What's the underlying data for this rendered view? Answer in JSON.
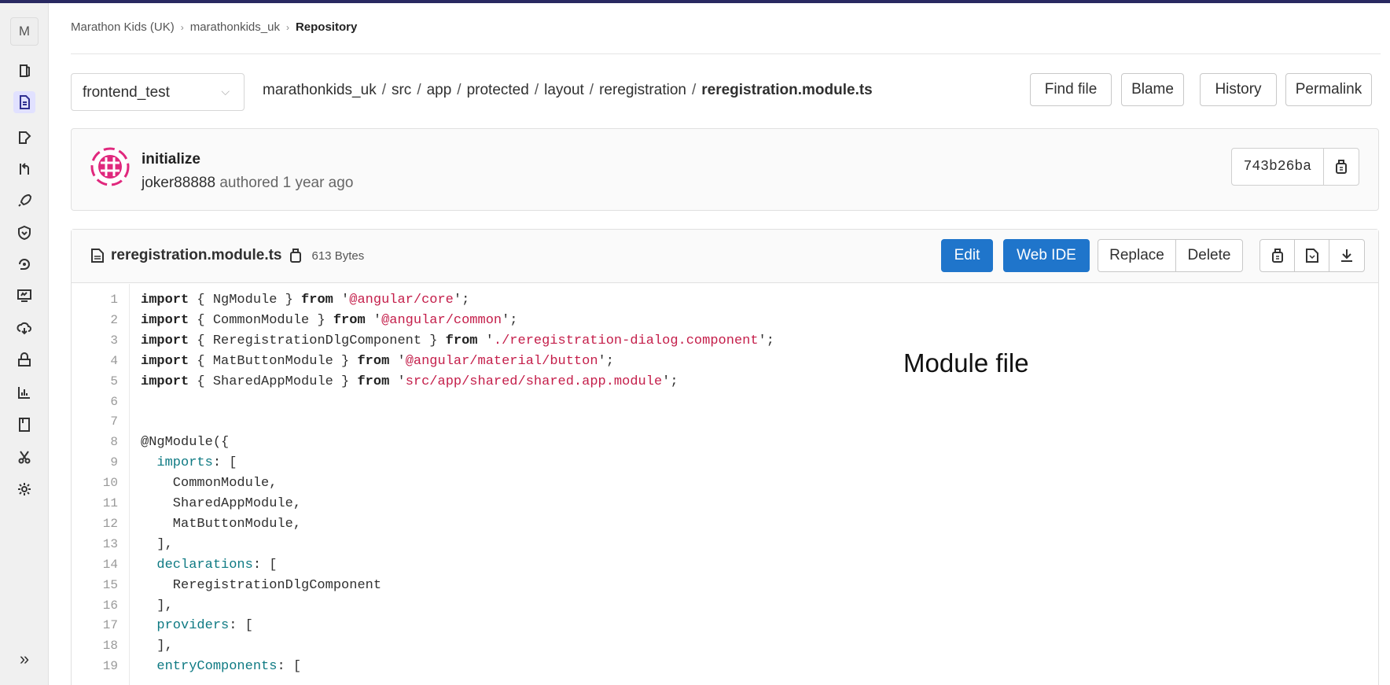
{
  "breadcrumb": {
    "items": [
      "Marathon Kids (UK)",
      "marathonkids_uk"
    ],
    "current": "Repository",
    "separator": "›"
  },
  "sidebar": {
    "avatar_letter": "M",
    "items": [
      {
        "icon": "project-overview-icon"
      },
      {
        "icon": "repository-icon",
        "active": true
      },
      {
        "icon": "issues-icon"
      },
      {
        "icon": "merge-requests-icon"
      },
      {
        "icon": "ci-cd-rocket-icon"
      },
      {
        "icon": "security-shield-icon"
      },
      {
        "icon": "deployments-icon"
      },
      {
        "icon": "monitor-icon"
      },
      {
        "icon": "infrastructure-cloud-icon"
      },
      {
        "icon": "packages-icon"
      },
      {
        "icon": "analytics-icon"
      },
      {
        "icon": "wiki-icon"
      },
      {
        "icon": "snippets-scissors-icon"
      },
      {
        "icon": "settings-gear-icon"
      }
    ],
    "collapse_label": "»"
  },
  "branch": {
    "value": "frontend_test"
  },
  "filepath": {
    "segments": [
      "marathonkids_uk",
      "src",
      "app",
      "protected",
      "layout",
      "reregistration"
    ],
    "filename": "reregistration.module.ts",
    "separator": "/"
  },
  "actions": {
    "find_file": "Find file",
    "blame": "Blame",
    "history": "History",
    "permalink": "Permalink"
  },
  "commit": {
    "title": "initialize",
    "author": "joker88888",
    "authored_text": "authored 1 year ago",
    "sha": "743b26ba"
  },
  "file": {
    "name": "reregistration.module.ts",
    "size": "613 Bytes",
    "buttons": {
      "edit": "Edit",
      "web_ide": "Web IDE",
      "replace": "Replace",
      "delete": "Delete"
    }
  },
  "code": {
    "line_numbers": [
      "1",
      "2",
      "3",
      "4",
      "5",
      "6",
      "7",
      "8",
      "9",
      "10",
      "11",
      "12",
      "13",
      "14",
      "15",
      "16",
      "17",
      "18",
      "19"
    ],
    "lines": [
      [
        {
          "t": "import",
          "c": "kw"
        },
        {
          "t": " { NgModule } "
        },
        {
          "t": "from",
          "c": "kw"
        },
        {
          "t": " '"
        },
        {
          "t": "@angular/core",
          "c": "str"
        },
        {
          "t": "';"
        }
      ],
      [
        {
          "t": "import",
          "c": "kw"
        },
        {
          "t": " { CommonModule } "
        },
        {
          "t": "from",
          "c": "kw"
        },
        {
          "t": " '"
        },
        {
          "t": "@angular/common",
          "c": "str"
        },
        {
          "t": "';"
        }
      ],
      [
        {
          "t": "import",
          "c": "kw"
        },
        {
          "t": " { ReregistrationDlgComponent } "
        },
        {
          "t": "from",
          "c": "kw"
        },
        {
          "t": " '"
        },
        {
          "t": "./reregistration-dialog.component",
          "c": "str"
        },
        {
          "t": "';"
        }
      ],
      [
        {
          "t": "import",
          "c": "kw"
        },
        {
          "t": " { MatButtonModule } "
        },
        {
          "t": "from",
          "c": "kw"
        },
        {
          "t": " '"
        },
        {
          "t": "@angular/material/button",
          "c": "str"
        },
        {
          "t": "';"
        }
      ],
      [
        {
          "t": "import",
          "c": "kw"
        },
        {
          "t": " { SharedAppModule } "
        },
        {
          "t": "from",
          "c": "kw"
        },
        {
          "t": " '"
        },
        {
          "t": "src/app/shared/shared.app.module",
          "c": "str"
        },
        {
          "t": "';"
        }
      ],
      [],
      [],
      [
        {
          "t": "@NgModule({"
        }
      ],
      [
        {
          "t": "  "
        },
        {
          "t": "imports",
          "c": "prop"
        },
        {
          "t": ": ["
        }
      ],
      [
        {
          "t": "    CommonModule,"
        }
      ],
      [
        {
          "t": "    SharedAppModule,"
        }
      ],
      [
        {
          "t": "    MatButtonModule,"
        }
      ],
      [
        {
          "t": "  ],"
        }
      ],
      [
        {
          "t": "  "
        },
        {
          "t": "declarations",
          "c": "prop"
        },
        {
          "t": ": ["
        }
      ],
      [
        {
          "t": "    ReregistrationDlgComponent"
        }
      ],
      [
        {
          "t": "  ],"
        }
      ],
      [
        {
          "t": "  "
        },
        {
          "t": "providers",
          "c": "prop"
        },
        {
          "t": ": ["
        }
      ],
      [
        {
          "t": "  ],"
        }
      ],
      [
        {
          "t": "  "
        },
        {
          "t": "entryComponents",
          "c": "prop"
        },
        {
          "t": ": ["
        }
      ]
    ]
  },
  "annotation": "Module file",
  "colors": {
    "primary": "#1f75cb",
    "topbar": "#292961",
    "string": "#c41e4a",
    "property": "#0f7a83"
  }
}
